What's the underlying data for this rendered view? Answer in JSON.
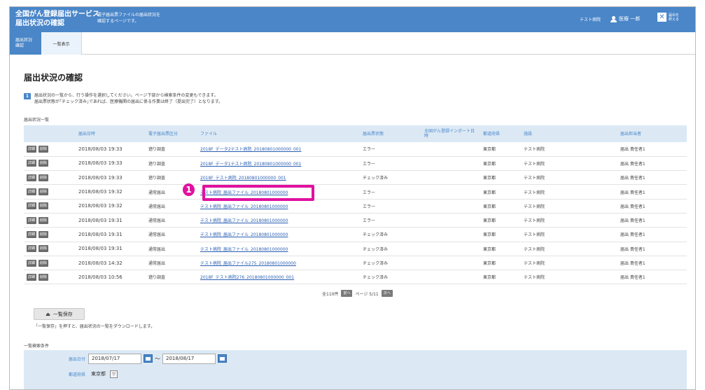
{
  "header": {
    "title_line1": "全国がん登録届出サービス",
    "title_line2": "届出状況の確認",
    "desc_line1": "電子届出票ファイルの届出状況を",
    "desc_line2": "確認するページです。",
    "hospital": "テスト病院",
    "user": "医療 一郎",
    "logout_line1": "届出を",
    "logout_line2": "終える",
    "close_glyph": "✕"
  },
  "tabs": [
    {
      "line1": "届出状況",
      "line2": "確認"
    },
    {
      "label": "一覧表示"
    }
  ],
  "page_title": "届出状況の確認",
  "info": {
    "num": "1",
    "line1": "届出状況の一覧から、行う操作を選択してください。ページ下部から検索条件の変更もできます。",
    "line2": "届出票状態が｢チェック済み｣であれば、医療機関の届出に係る作業は終了（提出完了）となります。"
  },
  "list_label": "届出状況一覧",
  "table": {
    "headers": [
      "",
      "届出日時",
      "電子届出票区分",
      "ファイル",
      "届出票状態",
      "全国がん登録インポート日時",
      "都道府県",
      "施設",
      "届出担当者"
    ],
    "detail_label": "詳細",
    "delete_label": "削除",
    "rows": [
      {
        "date": "2018/08/03 19:33",
        "kind": "遡り調査",
        "file": "2018F_データ2テスト病院_20180801000000_001",
        "status": "エラー",
        "error": true,
        "import": "",
        "pref": "東京都",
        "facility": "テスト病院",
        "person": "届出 責任者1"
      },
      {
        "date": "2018/08/03 19:33",
        "kind": "遡り調査",
        "file": "2018F_データ1テスト病院_20180801000000_001",
        "status": "エラー",
        "error": true,
        "import": "",
        "pref": "東京都",
        "facility": "テスト病院",
        "person": "届出 責任者1"
      },
      {
        "date": "2018/08/03 19:33",
        "kind": "遡り調査",
        "file": "2018F_テスト病院_20180801000000_001",
        "status": "チェック済み",
        "error": false,
        "import": "",
        "pref": "東京都",
        "facility": "テスト病院",
        "person": "届出 責任者1"
      },
      {
        "date": "2018/08/03 19:32",
        "kind": "通常届出",
        "file": "テスト病院_届出ファイル_20180801000000",
        "status": "エラー",
        "error": true,
        "import": "",
        "pref": "東京都",
        "facility": "テスト病院",
        "person": "届出 責任者1"
      },
      {
        "date": "2018/08/03 19:32",
        "kind": "通常届出",
        "file": "テスト病院_届出ファイル_20180801000000",
        "status": "エラー",
        "error": true,
        "import": "",
        "pref": "東京都",
        "facility": "テスト病院",
        "person": "届出 責任者1"
      },
      {
        "date": "2018/08/03 19:31",
        "kind": "通常届出",
        "file": "テスト病院_届出ファイル_20180801000000",
        "status": "エラー",
        "error": true,
        "import": "",
        "pref": "東京都",
        "facility": "テスト病院",
        "person": "届出 責任者1"
      },
      {
        "date": "2018/08/03 19:31",
        "kind": "通常届出",
        "file": "テスト病院_届出ファイル_20180801000000",
        "status": "チェック済み",
        "error": false,
        "import": "",
        "pref": "東京都",
        "facility": "テスト病院",
        "person": "届出 責任者1"
      },
      {
        "date": "2018/08/03 19:31",
        "kind": "通常届出",
        "file": "テスト病院_届出ファイル_20180801000000",
        "status": "チェック済み",
        "error": false,
        "import": "",
        "pref": "東京都",
        "facility": "テスト病院",
        "person": "届出 責任者1"
      },
      {
        "date": "2018/08/03 14:32",
        "kind": "通常届出",
        "file": "テスト病院_届出ファイル275_20180801000000",
        "status": "チェック済み",
        "error": false,
        "import": "",
        "pref": "東京都",
        "facility": "テスト病院",
        "person": "届出 責任者1"
      },
      {
        "date": "2018/08/03 10:56",
        "kind": "遡り調査",
        "file": "2018F_テスト病院276_20180801000000_001",
        "status": "チェック済み",
        "error": false,
        "import": "",
        "pref": "東京都",
        "facility": "テスト病院",
        "person": "届出 責任者1"
      }
    ]
  },
  "pager": {
    "total": "全110件",
    "prev": "前へ",
    "page": "ページ 5/11",
    "next": "次へ"
  },
  "save": {
    "icon": "⏏",
    "label": "一覧保存",
    "note": "「一覧保存」を押すと、届出状況の一覧をダウンロードします。"
  },
  "conditions": {
    "label": "一覧検索条件",
    "date_label": "届出日付",
    "date_from": "2018/07/17",
    "tilde": "～",
    "date_to": "2018/08/17",
    "pref_label": "都道府県",
    "pref_value": "東京都",
    "select_arrow": "▽"
  },
  "annotation": {
    "marker": "1"
  },
  "colors": {
    "primary": "#4a86c8",
    "error": "#e03030",
    "highlight": "#e0119f"
  }
}
